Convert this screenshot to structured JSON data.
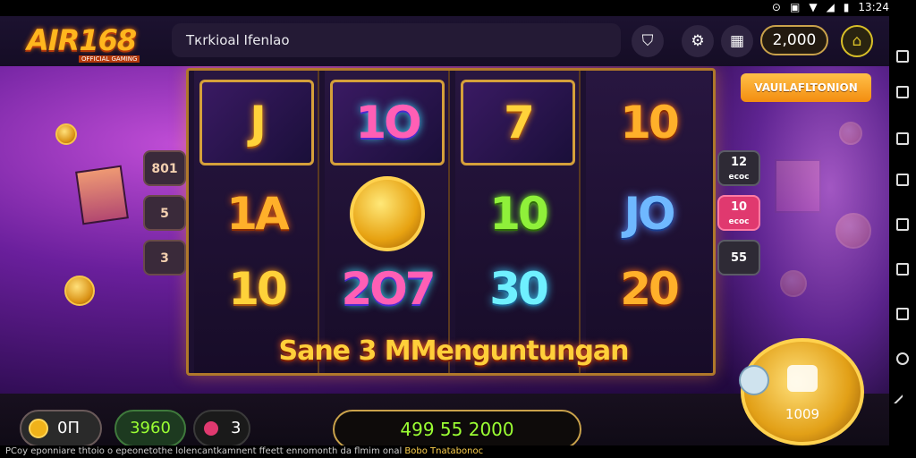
{
  "status_bar": {
    "time": "13:24"
  },
  "header": {
    "logo": "AIR168",
    "logo_sub": "OFFICIAL GAMING",
    "title": "Tкrkioal Ifenlao",
    "balance": "2,000"
  },
  "feature_button": "VAUILAFLTONION",
  "reels": [
    [
      "J",
      "1A",
      "10"
    ],
    [
      "1O",
      "coin",
      "2O7"
    ],
    [
      "7",
      "10",
      "30"
    ],
    [
      "10",
      "JO",
      "20"
    ]
  ],
  "banner": "Sane 3 MMenguntungan",
  "side_left": [
    "801",
    "5",
    "3"
  ],
  "side_right": [
    {
      "top": "12",
      "bottom": "ecoc"
    },
    {
      "top": "10",
      "bottom": "ecoc"
    },
    {
      "top": "55",
      "bottom": ""
    }
  ],
  "bottom": {
    "bet_label": "0Π",
    "win": "3960",
    "lines": "3",
    "spin_total": "499 55 2000",
    "big_coin_value": "1009"
  },
  "footer": {
    "text": "PCoy eponniare thtoio o epeonetothe lolencantkamnent ffeett ennomonth da flmim onal",
    "highlight": "Bobo Tnatabonoc"
  },
  "colors": {
    "accent_gold": "#ffd23a",
    "win_green": "#9bff33",
    "bg_purple": "#6a1f9c"
  }
}
